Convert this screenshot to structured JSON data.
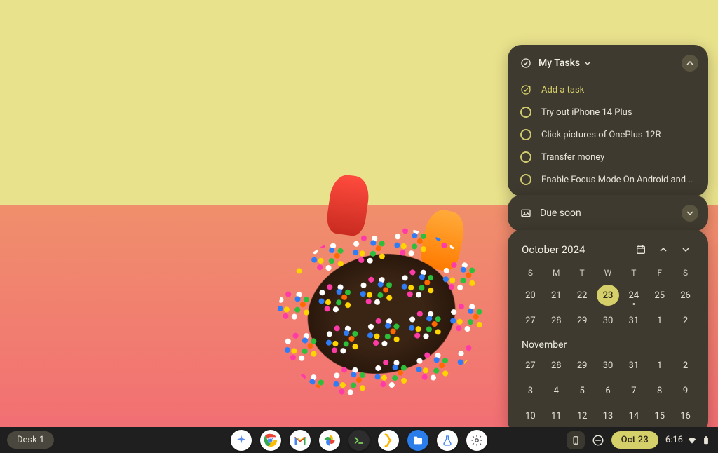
{
  "tasks": {
    "title": "My Tasks",
    "add_label": "Add a task",
    "items": [
      {
        "label": "Try out iPhone 14 Plus"
      },
      {
        "label": "Click pictures of OnePlus 12R"
      },
      {
        "label": "Transfer money"
      },
      {
        "label": "Enable Focus Mode On Android and Windows Arti..."
      }
    ],
    "due_soon_label": "Due soon"
  },
  "calendar": {
    "month_label": "October 2024",
    "dow": [
      "S",
      "M",
      "T",
      "W",
      "T",
      "F",
      "S"
    ],
    "oct_rows": [
      [
        "20",
        "21",
        "22",
        "23",
        "24",
        "25",
        "26"
      ],
      [
        "27",
        "28",
        "29",
        "30",
        "31",
        "1",
        "2"
      ]
    ],
    "today": "23",
    "dot_days": [
      "24"
    ],
    "next_month_label": "November",
    "nov_rows": [
      [
        "27",
        "28",
        "29",
        "30",
        "31",
        "1",
        "2"
      ],
      [
        "3",
        "4",
        "5",
        "6",
        "7",
        "8",
        "9"
      ],
      [
        "10",
        "11",
        "12",
        "13",
        "14",
        "15",
        "16"
      ]
    ]
  },
  "shelf": {
    "desk_label": "Desk 1",
    "date_label": "Oct 23",
    "time_label": "6:16",
    "icons": [
      "ai-sparkle-icon",
      "chrome-icon",
      "gmail-icon",
      "photos-icon",
      "terminal-icon",
      "code-icon",
      "files-icon",
      "labs-icon",
      "settings-icon"
    ]
  },
  "colors": {
    "panel": "#3e3a2f",
    "accent": "#d6d06a"
  }
}
